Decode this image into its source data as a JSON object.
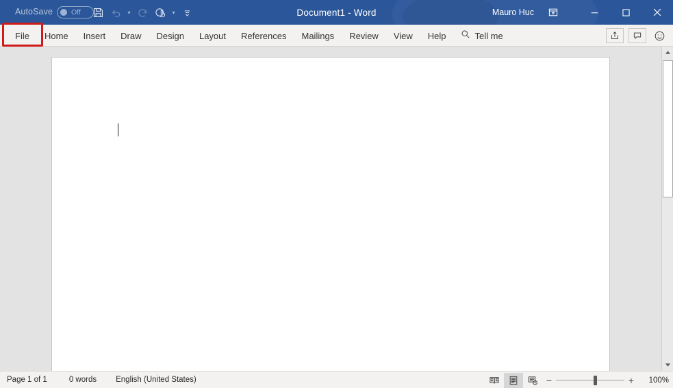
{
  "titlebar": {
    "autosave_label": "AutoSave",
    "autosave_state": "Off",
    "quick_access": [
      {
        "name": "save-icon",
        "label": "Save"
      },
      {
        "name": "undo-icon",
        "label": "Undo"
      },
      {
        "name": "redo-icon",
        "label": "Redo"
      },
      {
        "name": "touch-mouse-mode-icon",
        "label": "Touch/Mouse Mode"
      },
      {
        "name": "customize-quick-access-toolbar-icon",
        "label": "Customize Quick Access Toolbar"
      }
    ],
    "document_title": "Document1  -  Word",
    "account_name": "Mauro Huc",
    "ribbon_display_options": "Ribbon Display Options",
    "window_controls": {
      "minimize": "─",
      "maximize": "□",
      "close": "✕"
    }
  },
  "ribbon": {
    "tabs": [
      {
        "label": "File",
        "id": "file",
        "highlighted": true
      },
      {
        "label": "Home",
        "id": "home"
      },
      {
        "label": "Insert",
        "id": "insert"
      },
      {
        "label": "Draw",
        "id": "draw"
      },
      {
        "label": "Design",
        "id": "design"
      },
      {
        "label": "Layout",
        "id": "layout"
      },
      {
        "label": "References",
        "id": "references"
      },
      {
        "label": "Mailings",
        "id": "mailings"
      },
      {
        "label": "Review",
        "id": "review"
      },
      {
        "label": "View",
        "id": "view"
      },
      {
        "label": "Help",
        "id": "help"
      }
    ],
    "tell_me": "Tell me",
    "right_buttons": [
      {
        "name": "share-icon",
        "label": "Share"
      },
      {
        "name": "comments-icon",
        "label": "Comments"
      },
      {
        "name": "feedback-smiley-icon",
        "label": "Send a Smile"
      }
    ],
    "highlight_color": "#d01b1b"
  },
  "document": {
    "content": "",
    "caret_visible": true
  },
  "scrollbar": {
    "up_arrow": "▲",
    "down_arrow": "▼"
  },
  "statusbar": {
    "page_info": "Page 1 of 1",
    "word_count": "0 words",
    "language": "English (United States)",
    "views": [
      {
        "name": "read-mode-icon",
        "label": "Read Mode",
        "active": false
      },
      {
        "name": "print-layout-icon",
        "label": "Print Layout",
        "active": true
      },
      {
        "name": "web-layout-icon",
        "label": "Web Layout",
        "active": false
      }
    ],
    "zoom_out": "−",
    "zoom_in": "+",
    "zoom_level": "100%"
  },
  "colors": {
    "title_bar": "#2b579a",
    "ribbon_bg": "#f3f2f1",
    "workspace": "#e3e3e3",
    "page": "#ffffff",
    "accent_red": "#d01b1b"
  }
}
